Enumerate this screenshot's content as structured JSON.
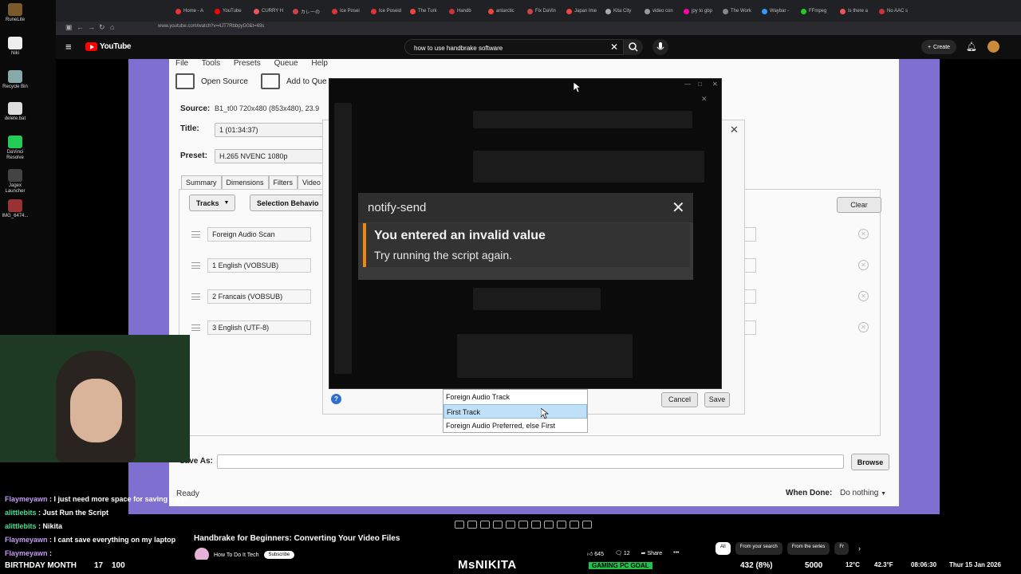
{
  "desktop": {
    "icons": [
      "RuneLite",
      "Niki",
      "Recycle Bin",
      "delete.bat",
      "DaVinci Resolve",
      "Jagex Launcher",
      "IMG_6474..."
    ]
  },
  "browser": {
    "tabs": [
      "Home - A",
      "YouTube",
      "CURRY H",
      "カレーの",
      "Ice Posei",
      "Ice Poseid",
      "The Turk",
      "Handb",
      "antarctic",
      "Fix DaVin",
      "Japan Ime",
      "Kita City",
      "video con",
      "jpy to gbp",
      "The Work",
      "Waybar -",
      "FFmpeg",
      "Is there a",
      "No AAC s"
    ],
    "url": "www.youtube.com/watch?v=4JT7RbbpyG0&t=69s"
  },
  "youtube": {
    "logo_text": "YouTube",
    "search_value": "how to use handbrake software",
    "create_label": "Create",
    "video_title": "Handbrake for Beginners: Converting Your Video Files",
    "channel_name": "How To Do It Tech",
    "subscribe_label": "Subscribe",
    "likes": "645",
    "comments": "12",
    "share_label": "Share",
    "chips": [
      "All",
      "From your search",
      "From the series",
      "Fr"
    ]
  },
  "handbrake": {
    "menu": [
      "File",
      "Tools",
      "Presets",
      "Queue",
      "Help"
    ],
    "open_source_label": "Open Source",
    "add_queue_label": "Add to Que",
    "source_label": "Source:",
    "source_value": "B1_t00   720x480 (853x480), 23.9",
    "title_label": "Title:",
    "title_value": "1  (01:34:37)",
    "preset_label": "Preset:",
    "preset_value": "H.265 NVENC 1080p",
    "tabs": [
      "Summary",
      "Dimensions",
      "Filters",
      "Video"
    ],
    "tracks_label": "Tracks",
    "selection_label": "Selection Behavio",
    "tracks": [
      "Foreign Audio Scan",
      "1 English (VOBSUB)",
      "2 Francais (VOBSUB)",
      "3 English (UTF-8)"
    ],
    "save_as_label": "Save As:",
    "browse_label": "Browse",
    "status": "Ready",
    "when_done_label": "When Done:",
    "when_done_value": "Do nothing"
  },
  "selection_dialog": {
    "clear_label": "Clear",
    "cancel_label": "Cancel",
    "save_label": "Save",
    "help_glyph": "?",
    "options": [
      "Foreign Audio Track",
      "First Track",
      "Foreign Audio Preferred, else First"
    ],
    "selected_index": 1
  },
  "notify": {
    "title": "notify-send",
    "message": "You entered an invalid value",
    "sub": "Try running the script again."
  },
  "chat": [
    {
      "user": "Flaymeyawn",
      "text": "I just need more space for saving vlogs"
    },
    {
      "user": "alittlebits",
      "text": "Just Run the Script"
    },
    {
      "user": "alittlebits",
      "text": "Nikita"
    },
    {
      "user": "Flaymeyawn",
      "text": "I cant save everything on my laptop"
    },
    {
      "user": "Flaymeyawn",
      "text": ""
    }
  ],
  "overlay": {
    "birthday": "BIRTHDAY MONTH",
    "count1": "17",
    "pct": "100",
    "brand": "MsNIKITA",
    "goal": "GAMING PC GOAL",
    "goal_progress": "432 (8%)",
    "goal_target": "5000",
    "temp": "12°C",
    "temp2": "42.3°F",
    "time": "08:06:30",
    "date": "Thur 15 Jan 2026"
  },
  "colors": {
    "purple_bg": "#7f6fd0",
    "accent_orange": "#f0860f",
    "selection_blue": "#bfe0f6",
    "youtube_red": "#ff0000"
  }
}
